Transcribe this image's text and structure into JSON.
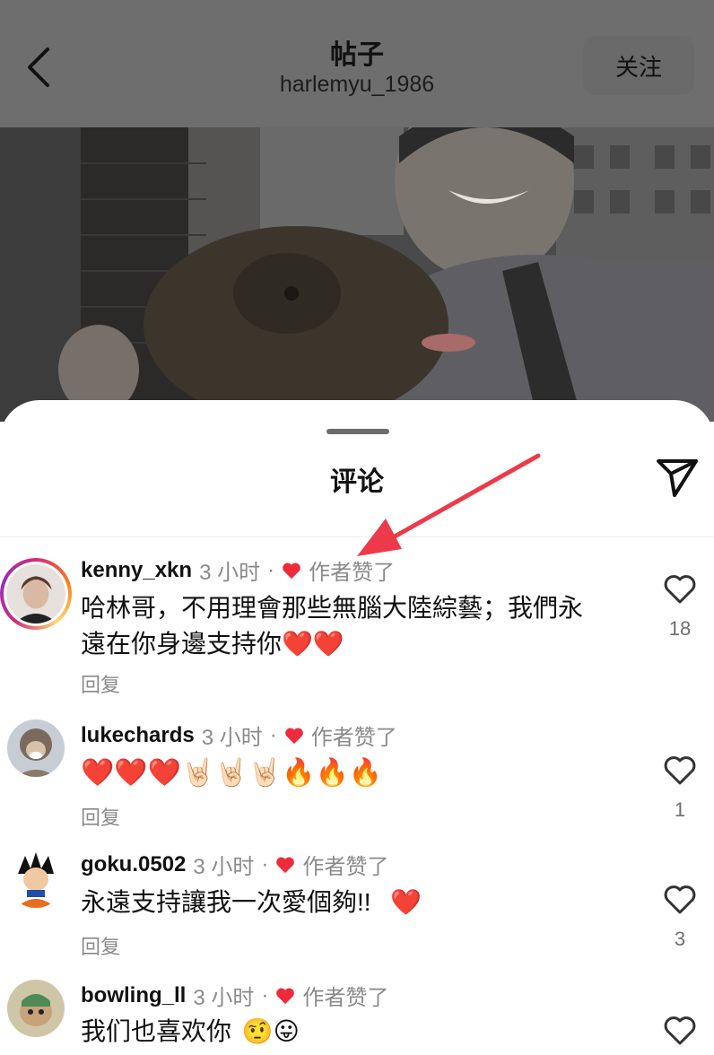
{
  "header": {
    "title": "帖子",
    "username": "harlemyu_1986",
    "follow_label": "关注"
  },
  "sheet": {
    "title": "评论"
  },
  "comments": [
    {
      "username": "kenny_xkn",
      "time": "3 小时",
      "dot": "·",
      "author_liked": "作者赞了",
      "text_line1": "哈林哥，不用理會那些無腦大陸綜藝；我們永",
      "text_line2": "遠在你身邊支持你",
      "text_emoji": "❤️❤️",
      "reply": "回复",
      "likes": "18"
    },
    {
      "username": "lukechards",
      "time": "3 小时",
      "dot": "·",
      "author_liked": "作者赞了",
      "text_emoji": "❤️❤️❤️🤘🏻🤘🏻🤘🏻🔥🔥🔥",
      "reply": "回复",
      "likes": "1"
    },
    {
      "username": "goku.0502",
      "time": "3 小时",
      "dot": "·",
      "author_liked": "作者赞了",
      "text": "永遠支持讓我一次愛個夠!!",
      "text_emoji": "❤️",
      "reply": "回复",
      "likes": "3"
    },
    {
      "username": "bowling_ll",
      "time": "3 小时",
      "dot": "·",
      "author_liked": "作者赞了",
      "text": "我们也喜欢你",
      "text_emoji": "🤨😛"
    }
  ],
  "colors": {
    "accent_red": "#ed2b3c",
    "muted_text": "#8a8a8a",
    "overlay": "#6e6e6e"
  }
}
